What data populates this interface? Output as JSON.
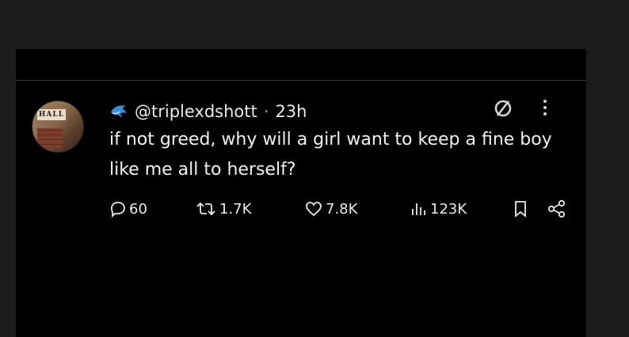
{
  "tweet": {
    "handle": "@triplexdshott",
    "separator": "·",
    "time": "23h",
    "text": "if not greed, why will a girl want to keep a fine boy like me all to herself?",
    "avatar_sign": "HALL"
  },
  "actions": {
    "replies": "60",
    "reposts": "1.7K",
    "likes": "7.8K",
    "views": "123K"
  },
  "icons": {
    "badge": "dolphin-icon",
    "grok": "slashed-circle-icon",
    "more": "more-vertical-icon",
    "reply": "reply-bubble-icon",
    "repost": "repost-icon",
    "like": "heart-icon",
    "views": "bar-chart-icon",
    "bookmark": "bookmark-icon",
    "share": "share-icon"
  },
  "colors": {
    "page_bg": "#1c1c1c",
    "card_bg": "#000000",
    "text": "#e7e9ea",
    "badge_blue": "#3b8fd9"
  }
}
